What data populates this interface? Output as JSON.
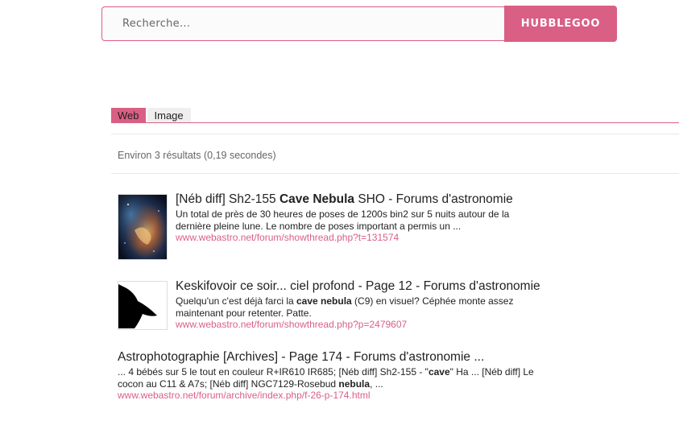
{
  "search": {
    "placeholder": "Recherche...",
    "button_label": "HUBBLEGOO"
  },
  "tabs": [
    {
      "label": "Web",
      "active": true
    },
    {
      "label": "Image",
      "active": false
    }
  ],
  "stats": "Environ 3 résultats (0,19 secondes)",
  "results": [
    {
      "thumbnail": "nebula-photo",
      "title_pre": "[Néb diff] Sh2-155 ",
      "title_bold": "Cave Nebula",
      "title_post": " SHO - Forums d'astronomie",
      "snippet": "Un total de près de 30 heures de poses de 1200s bin2 sur 5 nuits autour de la dernière pleine lune. Le nombre de poses important a permis un ...",
      "url": "www.webastro.net/forum/showthread.php?t=131574"
    },
    {
      "thumbnail": "black-silhouette",
      "title": "Keskifovoir ce soir... ciel profond - Page 12 - Forums d'astronomie",
      "snippet_pre": "Quelqu'un c'est déjà farci la ",
      "snippet_bold": "cave nebula",
      "snippet_post": " (C9) en visuel? Céphée monte assez maintenant pour retenter. Patte.",
      "url": "www.webastro.net/forum/showthread.php?p=2479607"
    },
    {
      "title": "Astrophotographie [Archives] - Page 174 - Forums d'astronomie ...",
      "snippet_pre": "... 4 bébés sur 5 le tout en couleur R+IR610 IR685; [Néb diff] Sh2-155 - \"",
      "snippet_bold1": "cave",
      "snippet_mid": "\" Ha ... [Néb diff] Le cocon au C11 & A7s; [Néb diff] NGC7129-Rosebud ",
      "snippet_bold2": "nebula",
      "snippet_post": ", ...",
      "url": "www.webastro.net/forum/archive/index.php/f-26-p-174.html"
    }
  ],
  "colors": {
    "accent": "#d95f84",
    "url": "#d95f84",
    "stats": "#666666"
  }
}
